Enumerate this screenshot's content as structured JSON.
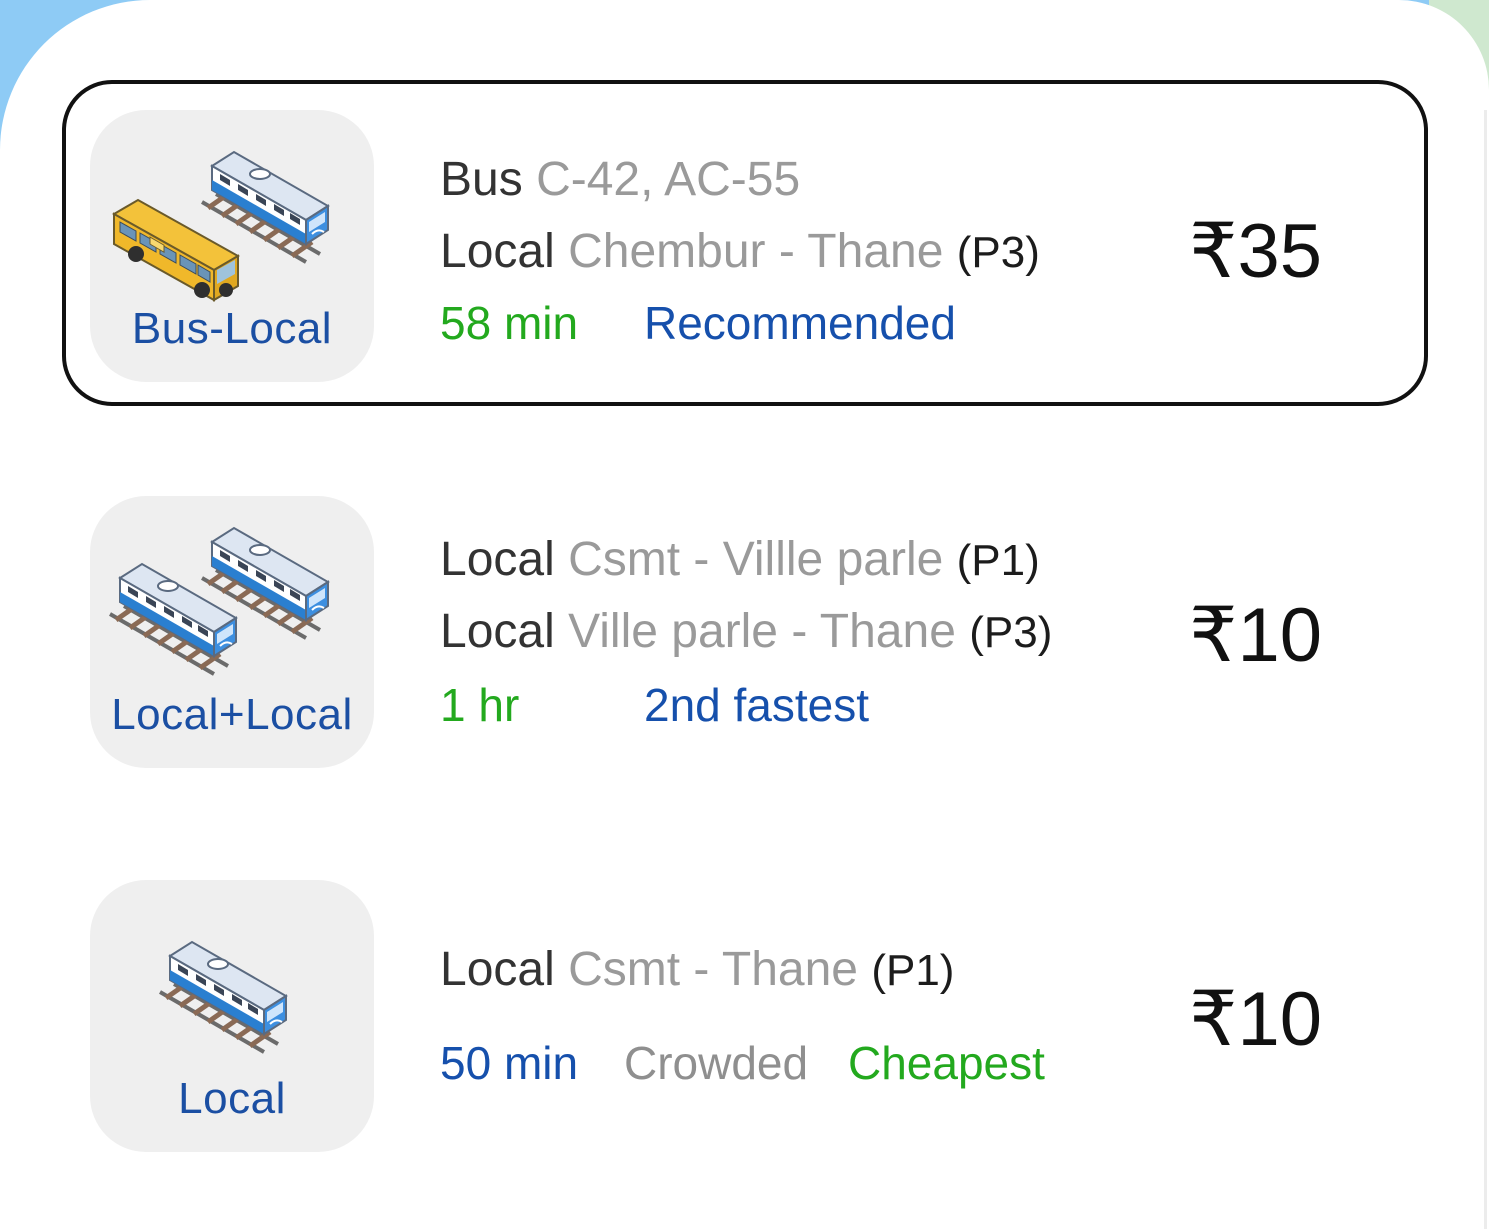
{
  "routes": [
    {
      "mode_label": "Bus-Local",
      "mode_icon": "bus-and-train-icon",
      "legs": [
        {
          "mode": "Bus",
          "route": "C-42, AC-55",
          "platform": ""
        },
        {
          "mode": "Local",
          "route": "Chembur - Thane",
          "platform": "(P3)"
        }
      ],
      "duration": "58 min",
      "tag": "Recommended",
      "fare": "₹35",
      "selected": true
    },
    {
      "mode_label": "Local+Local",
      "mode_icon": "two-trains-icon",
      "legs": [
        {
          "mode": "Local",
          "route": "Csmt - Villle parle",
          "platform": "(P1)"
        },
        {
          "mode": "Local",
          "route": "Ville parle - Thane",
          "platform": "(P3)"
        }
      ],
      "duration": "1 hr",
      "tag": "2nd fastest",
      "fare": "₹10",
      "selected": false
    },
    {
      "mode_label": "Local",
      "mode_icon": "train-icon",
      "legs": [
        {
          "mode": "Local",
          "route": "Csmt - Thane",
          "platform": "(P1)"
        }
      ],
      "duration": "50 min",
      "crowd": "Crowded",
      "tag": "Cheapest",
      "fare": "₹10",
      "selected": false
    }
  ],
  "colors": {
    "green": "#23a91e",
    "blue": "#1650ac",
    "grey_text": "#9a9a9a",
    "tile_bg": "#efefef",
    "selected_border": "#111111"
  }
}
